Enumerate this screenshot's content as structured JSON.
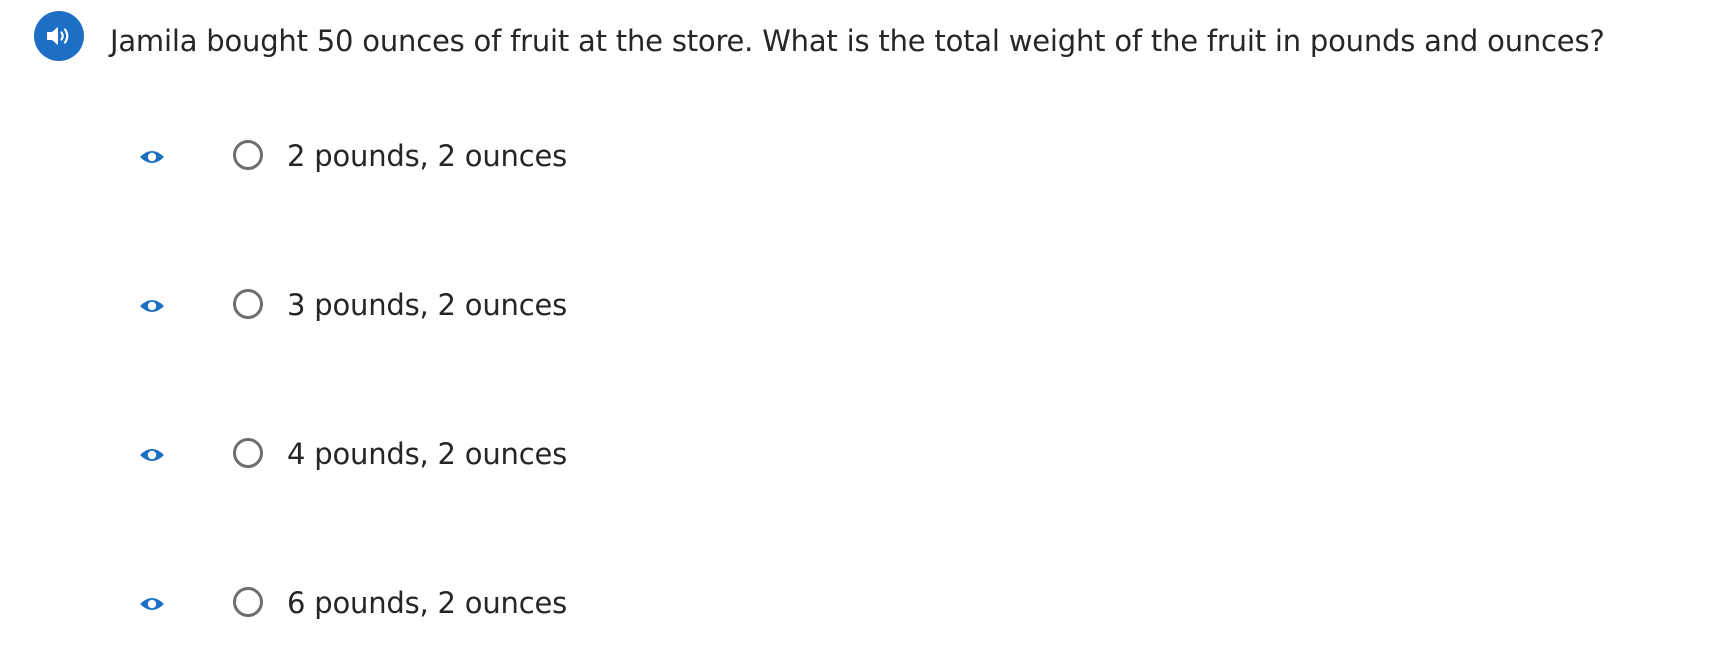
{
  "question": {
    "text": "Jamila bought 50 ounces of fruit at the store. What is the total weight of the fruit in pounds and ounces?",
    "audio_icon": "speaker-icon"
  },
  "options": [
    {
      "label": "2 pounds, 2 ounces",
      "eye_icon": "eye-icon"
    },
    {
      "label": "3 pounds, 2 ounces",
      "eye_icon": "eye-icon"
    },
    {
      "label": "4 pounds, 2 ounces",
      "eye_icon": "eye-icon"
    },
    {
      "label": "6 pounds, 2 ounces",
      "eye_icon": "eye-icon"
    }
  ],
  "colors": {
    "accent": "#1d6ec5",
    "text": "#262626",
    "radio_border": "#6e6e6e"
  }
}
